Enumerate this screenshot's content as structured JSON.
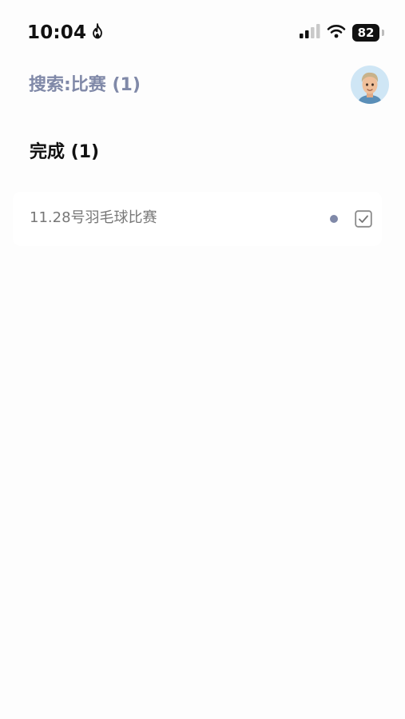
{
  "status_bar": {
    "time": "10:04",
    "battery_level": "82",
    "icons": [
      "activity-flame-icon",
      "cellular-signal-icon",
      "wifi-icon",
      "battery-icon"
    ]
  },
  "header": {
    "search_title": "搜索:比赛 (1)",
    "avatar_icon": "memoji-avatar-icon"
  },
  "section": {
    "title": "完成 (1)"
  },
  "tasks": [
    {
      "label": "11.28号羽毛球比赛",
      "completed": true,
      "priority_color": "#8089a8"
    }
  ],
  "colors": {
    "accent": "#8089a8",
    "background": "#fdfdfd",
    "avatar_background": "#cfe6f5"
  }
}
